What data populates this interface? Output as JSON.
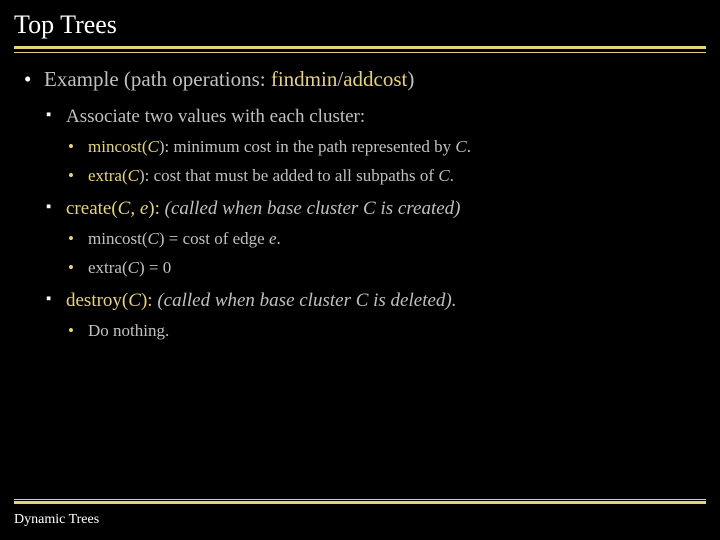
{
  "title": "Top Trees",
  "main": {
    "example_prefix": "Example (path operations: ",
    "findmin": "findmin",
    "slash": "/",
    "addcost": "addcost",
    "closep": ")",
    "assoc": "Associate two values with each cluster:",
    "mincost_label": "mincost(",
    "mincost_var": "C",
    "mincost_desc": "): minimum cost in the path represented by ",
    "mincost_var2": "C",
    "mincost_dot": ".",
    "extra_label": "extra(",
    "extra_var": "C",
    "extra_desc": "): cost that must be added to all subpaths of ",
    "extra_var2": "C",
    "extra_dot": ".",
    "create_label": "create(",
    "create_vars": "C, e",
    "create_close": "):",
    "create_desc": " (called when base cluster C is created)",
    "create_sub1a": "mincost(",
    "create_sub1b": "C",
    "create_sub1c": ") = cost of edge ",
    "create_sub1d": "e",
    "create_sub1e": ".",
    "create_sub2a": "extra(",
    "create_sub2b": "C",
    "create_sub2c": ") = 0",
    "destroy_label": "destroy(",
    "destroy_var": "C",
    "destroy_close": "):",
    "destroy_desc": " (called when base cluster C is deleted).",
    "destroy_sub": "Do nothing."
  },
  "footer": "Dynamic Trees"
}
